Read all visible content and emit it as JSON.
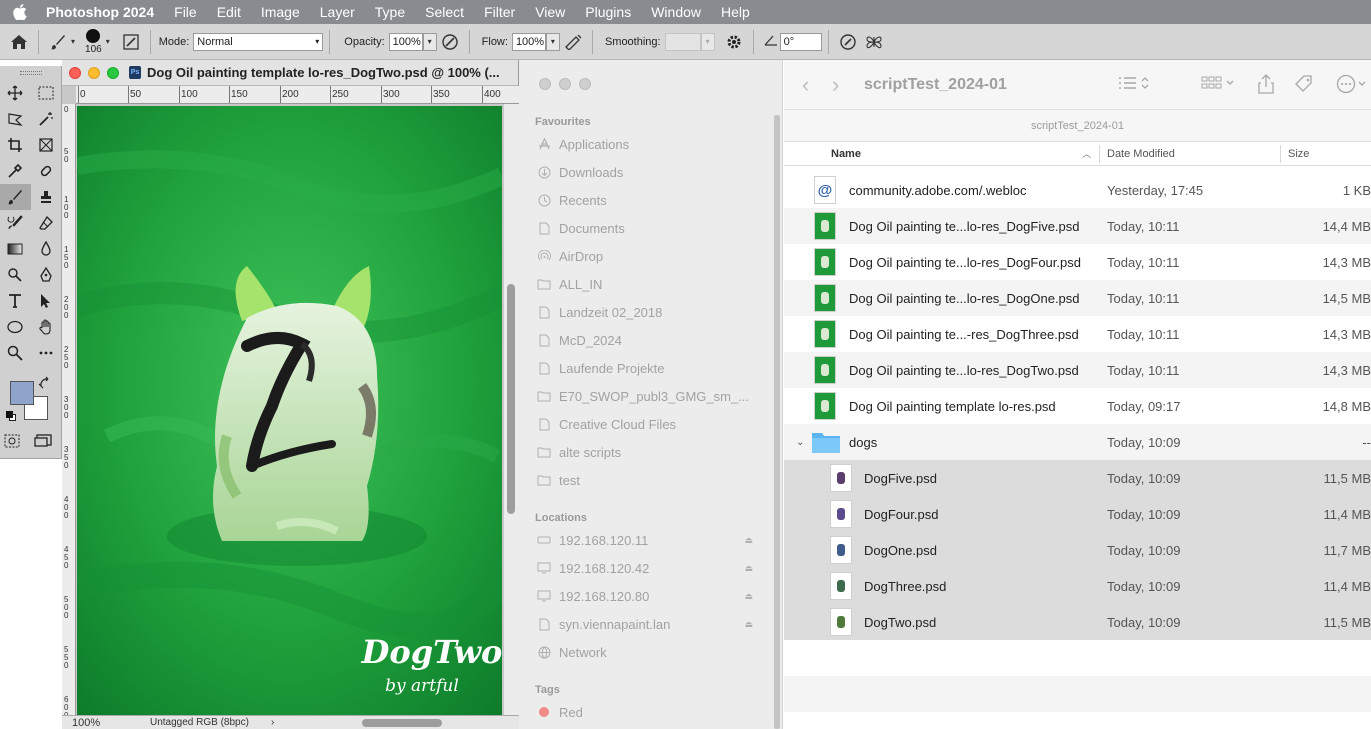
{
  "menubar": {
    "app_name": "Photoshop 2024",
    "items": [
      "File",
      "Edit",
      "Image",
      "Layer",
      "Type",
      "Select",
      "Filter",
      "View",
      "Plugins",
      "Window",
      "Help"
    ]
  },
  "options_bar": {
    "brush_size": "106",
    "mode_label": "Mode:",
    "mode_value": "Normal",
    "opacity_label": "Opacity:",
    "opacity_value": "100%",
    "flow_label": "Flow:",
    "flow_value": "100%",
    "smoothing_label": "Smoothing:",
    "smoothing_value": "",
    "angle_value": "0°"
  },
  "tools": {
    "foreground_color": "#8fa4cb",
    "background_color": "#ffffff"
  },
  "document": {
    "title": "Dog Oil painting template lo-res_DogTwo.psd @ 100% (...",
    "ps_badge": "Ps",
    "ruler_top": [
      "0",
      "50",
      "100",
      "150",
      "200",
      "250",
      "300",
      "350",
      "400"
    ],
    "ruler_left": [
      "0",
      "5 0",
      "1 0 0",
      "1 5 0",
      "2 0 0",
      "2 5 0",
      "3 0 0",
      "3 5 0",
      "4 0 0",
      "4 5 0",
      "5 0 0",
      "5 5 0",
      "6 0 0"
    ],
    "zoom": "100%",
    "color_profile": "Untagged RGB (8bpc)",
    "canvas_main_text": "DogTwo",
    "canvas_sub_text": "by artful",
    "canvas_color": "#1f9a3a"
  },
  "finder": {
    "favourites_header": "Favourites",
    "favourites": [
      "Applications",
      "Downloads",
      "Recents",
      "Documents",
      "AirDrop",
      "ALL_IN",
      "Landzeit 02_2018",
      "McD_2024",
      "Laufende Projekte",
      "E70_SWOP_publ3_GMG_sm_...",
      "Creative Cloud Files",
      "alte scripts",
      "test"
    ],
    "locations_header": "Locations",
    "locations": [
      "192.168.120.11",
      "192.168.120.42",
      "192.168.120.80",
      "syn.viennapaint.lan",
      "Network"
    ],
    "tags_header": "Tags",
    "tags": [
      "Red"
    ],
    "title": "scriptTest_2024-01",
    "path": "scriptTest_2024-01",
    "columns": {
      "name": "Name",
      "date": "Date Modified",
      "size": "Size"
    },
    "rows": [
      {
        "name": "community.adobe.com/.webloc",
        "date": "Yesterday, 17:45",
        "size": "1 KB"
      },
      {
        "name": "Dog Oil painting te...lo-res_DogFive.psd",
        "date": "Today, 10:11",
        "size": "14,4 MB"
      },
      {
        "name": "Dog Oil painting te...lo-res_DogFour.psd",
        "date": "Today, 10:11",
        "size": "14,3 MB"
      },
      {
        "name": "Dog Oil painting te...lo-res_DogOne.psd",
        "date": "Today, 10:11",
        "size": "14,5 MB"
      },
      {
        "name": "Dog Oil painting te...-res_DogThree.psd",
        "date": "Today, 10:11",
        "size": "14,3 MB"
      },
      {
        "name": "Dog Oil painting te...lo-res_DogTwo.psd",
        "date": "Today, 10:11",
        "size": "14,3 MB"
      },
      {
        "name": "Dog Oil painting template lo-res.psd",
        "date": "Today, 09:17",
        "size": "14,8 MB"
      },
      {
        "name": "dogs",
        "date": "Today, 10:09",
        "size": "--"
      },
      {
        "name": "DogFive.psd",
        "date": "Today, 10:09",
        "size": "11,5 MB"
      },
      {
        "name": "DogFour.psd",
        "date": "Today, 10:09",
        "size": "11,4 MB"
      },
      {
        "name": "DogOne.psd",
        "date": "Today, 10:09",
        "size": "11,7 MB"
      },
      {
        "name": "DogThree.psd",
        "date": "Today, 10:09",
        "size": "11,4 MB"
      },
      {
        "name": "DogTwo.psd",
        "date": "Today, 10:09",
        "size": "11,5 MB"
      }
    ]
  }
}
